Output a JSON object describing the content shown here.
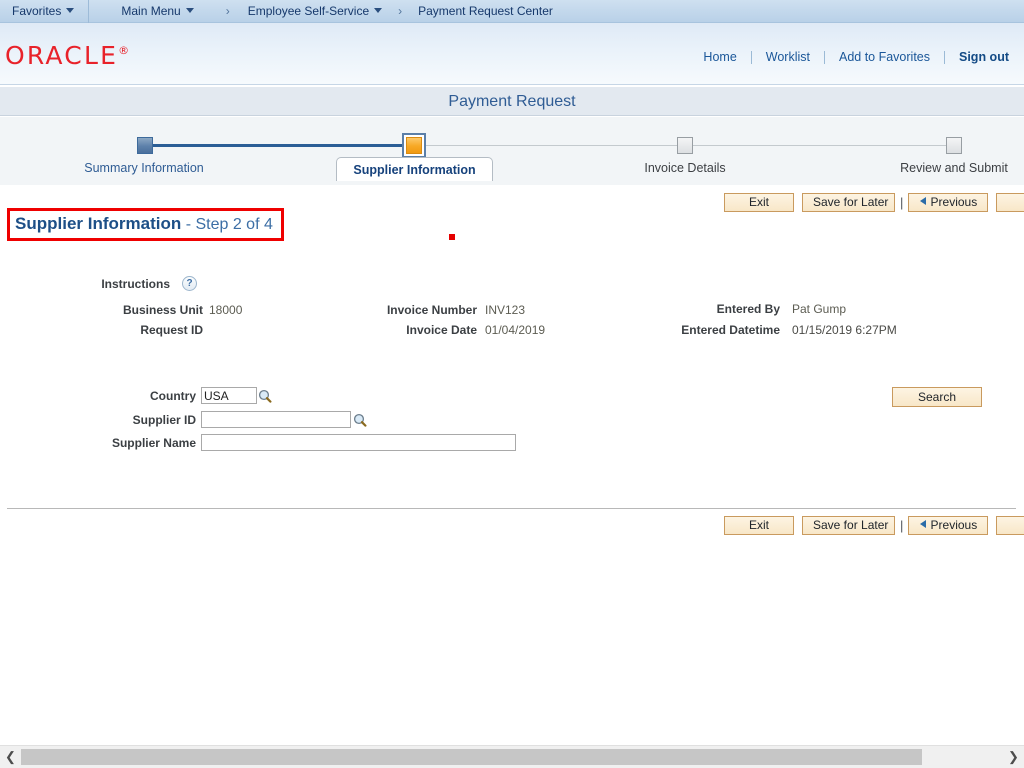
{
  "breadcrumb": {
    "favorites": "Favorites",
    "main_menu": "Main Menu",
    "arrow": "›",
    "level1": "Employee Self-Service",
    "level2": "Payment Request Center"
  },
  "header": {
    "logo": "ORACLE",
    "logo_tm": "®",
    "links": {
      "home": "Home",
      "worklist": "Worklist",
      "add_to_favorites": "Add to Favorites",
      "sign_out": "Sign out"
    }
  },
  "page": {
    "title": "Payment Request"
  },
  "train": {
    "steps": [
      {
        "label": "Summary Information",
        "state": "done"
      },
      {
        "label": "Supplier Information",
        "state": "current"
      },
      {
        "label": "Invoice Details",
        "state": "todo"
      },
      {
        "label": "Review and Submit",
        "state": "todo"
      }
    ]
  },
  "step_heading": {
    "title": "Supplier Information",
    "subtitle": "- Step 2 of 4",
    "highlight_color": "#ef0000"
  },
  "toolbar": {
    "exit": "Exit",
    "save_for_later": "Save for Later",
    "separator": "|",
    "previous": "Previous",
    "next": ""
  },
  "info": {
    "instructions_label": "Instructions",
    "help_icon": "?",
    "business_unit_label": "Business Unit",
    "business_unit_value": "18000",
    "request_id_label": "Request ID",
    "request_id_value": "",
    "invoice_number_label": "Invoice Number",
    "invoice_number_value": "INV123",
    "invoice_date_label": "Invoice Date",
    "invoice_date_value": "01/04/2019",
    "entered_by_label": "Entered By",
    "entered_by_value": "Pat Gump",
    "entered_datetime_label": "Entered Datetime",
    "entered_datetime_value": "01/15/2019  6:27PM"
  },
  "search_form": {
    "country_label": "Country",
    "country_value": "USA",
    "supplier_id_label": "Supplier ID",
    "supplier_id_value": "",
    "supplier_name_label": "Supplier Name",
    "supplier_name_value": "",
    "search_button": "Search"
  },
  "scrollbar": {
    "left_arrow": "❮",
    "right_arrow": "❯"
  }
}
